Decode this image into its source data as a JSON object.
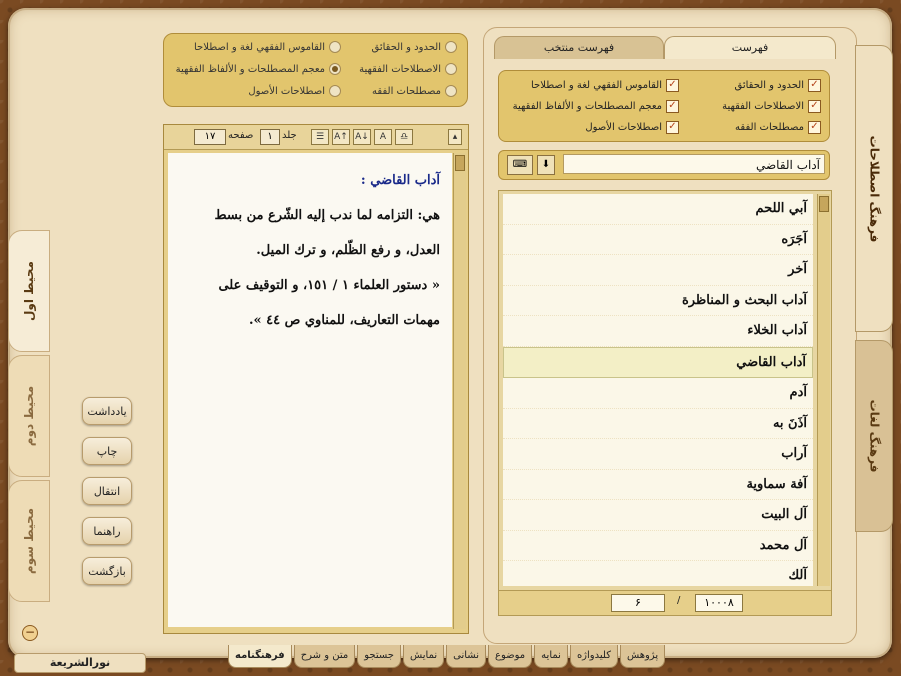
{
  "app": {
    "name": "نورالشريعة"
  },
  "left_tabs": [
    "محیط اول",
    "محیط دوم",
    "محیط سوم"
  ],
  "side_buttons": [
    "یادداشت",
    "چاپ",
    "انتقال",
    "راهنما",
    "بازگشت"
  ],
  "middle_options": {
    "col_right": [
      "الحدود و الحقائق",
      "الاصطلاحات الفقهیة",
      "مصطلحات الفقه"
    ],
    "col_left": [
      "القاموس الفقهي لغة و اصطلاحا",
      "معجم المصطلحات و الألفاظ الفقهیة",
      "اصطلاحات الأصول"
    ],
    "selected": "معجم المصطلحات و الألفاظ الفقهیة"
  },
  "toolbar": {
    "volume_label": "جلد",
    "volume_value": "۱",
    "page_label": "صفحه",
    "page_value": "۱۷"
  },
  "definition": {
    "title": "آداب القاضي :",
    "body": "هي: التزامه لما ندب إليه الشّرع من بسط العدل، و رفع الظّلم، و ترك الميل.",
    "reference": "« دستور العلماء ١ / ١٥١، و التوقيف على مهمات التعاريف، للمناوي ص ٤٤ »."
  },
  "right_panel": {
    "tabs": [
      "فهرست",
      "فهرست منتخب"
    ],
    "active_tab": "فهرست",
    "checkboxes": {
      "col_right": [
        "الحدود و الحقائق",
        "الاصطلاحات الفقهیة",
        "مصطلحات الفقه"
      ],
      "col_left": [
        "القاموس الفقهي لغة و اصطلاحا",
        "معجم المصطلحات و الألفاظ الفقهیة",
        "اصطلاحات الأصول"
      ]
    },
    "search_value": "آداب القاضي",
    "list": [
      "آبي اللحم",
      "آجَرَه",
      "آخر",
      "آداب البحث و المناظرة",
      "آداب الخلاء",
      "آداب القاضي",
      "آدم",
      "آذَنَ به",
      "آراب",
      "آفة سماوية",
      "آل البيت",
      "آل محمد",
      "آلك"
    ],
    "selected_item": "آداب القاضي",
    "pager": {
      "total": "۱۰۰۰۸",
      "separator": "/",
      "current": "۶"
    }
  },
  "right_vtabs": [
    "فرهنگ اصطلاحات",
    "فرهنگ لغات"
  ],
  "bottom_tabs": [
    "فرهنگنامه",
    "متن و شرح",
    "جستجو",
    "نمایش",
    "نشانی",
    "موضوع",
    "نمایه",
    "کلیدواژه",
    "پژوهش"
  ],
  "active_bottom_tab": "فرهنگنامه",
  "colors": {
    "frame": "#efe0c0",
    "gold": "#e2c56d",
    "title_blue": "#1a2a8a",
    "background": "#7a4a22"
  }
}
